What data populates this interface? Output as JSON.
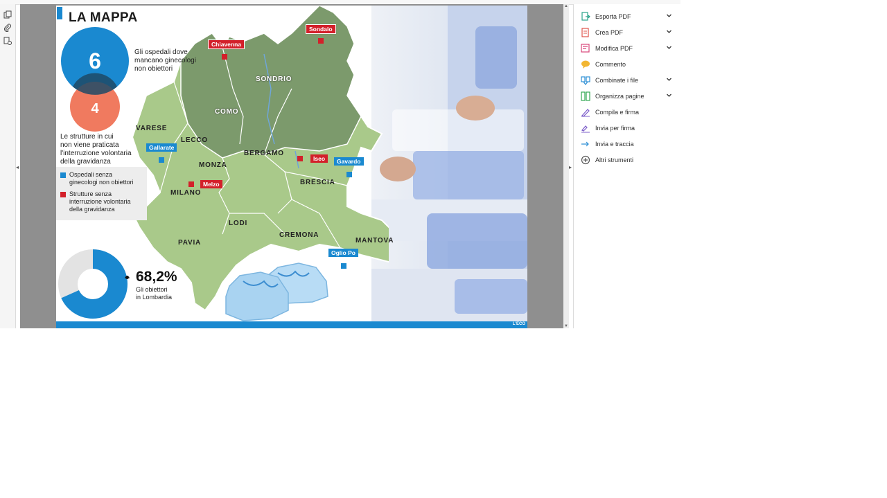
{
  "left_rail": {
    "icons": [
      "copy-pages-icon",
      "attachment-icon",
      "document-lock-icon"
    ]
  },
  "document": {
    "title": "LA MAPPA",
    "stat_hospitals": {
      "value": "6",
      "caption": [
        "Gli ospedali dove",
        "mancano ginecologi",
        "non obiettori"
      ]
    },
    "stat_structures": {
      "value": "4",
      "caption": [
        "Le strutture in cui",
        "non viene praticata",
        "l'interruzione volontaria",
        "della gravidanza"
      ]
    },
    "legend": [
      {
        "color": "#1a89d0",
        "lines": [
          "Ospedali senza",
          "ginecologi non obiettori"
        ]
      },
      {
        "color": "#d3202a",
        "lines": [
          "Strutture senza",
          "interruzione volontaria",
          "della gravidanza"
        ]
      }
    ],
    "objectors": {
      "value": "68,2%",
      "fraction": 0.682,
      "caption": [
        "Gli obiettori",
        "in Lombardia"
      ]
    },
    "provinces": [
      "SONDRIO",
      "COMO",
      "VARESE",
      "LECCO",
      "BERGAMO",
      "MONZA",
      "MILANO",
      "BRESCIA",
      "LODI",
      "CREMONA",
      "MANTOVA",
      "PAVIA"
    ],
    "hospitals_blue": [
      "Gallarate",
      "Gavardo",
      "Oglio Po"
    ],
    "hospitals_red": [
      "Chiavenna",
      "Sondalo",
      "Iseo",
      "Melzo"
    ],
    "footer_logo": "L'ECO",
    "colors": {
      "blue": "#1a89d0",
      "red": "#d3202a",
      "salmon": "#f07a5f",
      "map_green": "#a9c98a"
    }
  },
  "tools": [
    {
      "label": "Esporta PDF",
      "icon": "export-pdf-icon",
      "color": "#2aa38a",
      "expand": true
    },
    {
      "label": "Crea PDF",
      "icon": "create-pdf-icon",
      "color": "#e0544b",
      "expand": true
    },
    {
      "label": "Modifica PDF",
      "icon": "edit-pdf-icon",
      "color": "#d9457a",
      "expand": true
    },
    {
      "label": "Commento",
      "icon": "comment-icon",
      "color": "#f2b632",
      "expand": false
    },
    {
      "label": "Combinate i file",
      "icon": "combine-files-icon",
      "color": "#2d8fd5",
      "expand": true
    },
    {
      "label": "Organizza pagine",
      "icon": "organize-pages-icon",
      "color": "#34a853",
      "expand": true
    },
    {
      "label": "Compila e firma",
      "icon": "fill-sign-icon",
      "color": "#7b5cc9",
      "expand": false
    },
    {
      "label": "Invia per firma",
      "icon": "send-signature-icon",
      "color": "#7b5cc9",
      "expand": false
    },
    {
      "label": "Invia e traccia",
      "icon": "send-track-icon",
      "color": "#2d8fd5",
      "expand": false
    },
    {
      "label": "Altri strumenti",
      "icon": "more-tools-icon",
      "color": "#555555",
      "expand": false
    }
  ]
}
